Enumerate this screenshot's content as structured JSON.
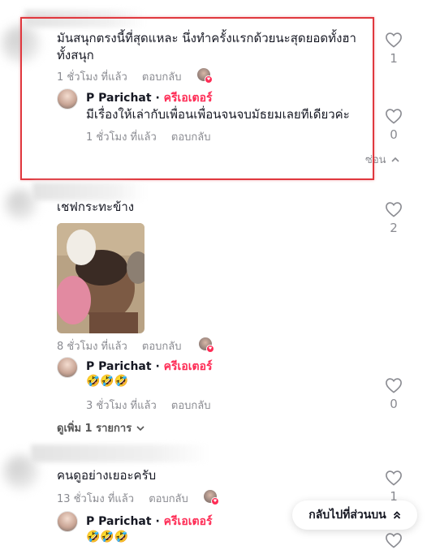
{
  "comment1": {
    "text": "มันสนุกตรงนี้ที่สุดแหละ นึ่งทำครั้งแรกด้วยนะสุดยอดทั้งฮาทั้งสนุก",
    "time": "1 ชั่วโมง ที่แล้ว",
    "reply_label": "ตอบกลับ",
    "likes": "1",
    "reply": {
      "author": "P Parichat",
      "separator": "·",
      "badge": "ครีเอเตอร์",
      "text": "มีเรื่องให้เล่ากับเพื่อนเพื่อนจนจบมัธยมเลยทีเดียวค่ะ",
      "time": "1 ชั่วโมง ที่แล้ว",
      "reply_label": "ตอบกลับ",
      "likes": "0"
    },
    "hide_label": "ซ่อน"
  },
  "comment2": {
    "text": "เชฟกระทะข้าง",
    "time": "8 ชั่วโมง ที่แล้ว",
    "reply_label": "ตอบกลับ",
    "likes": "2",
    "reply": {
      "author": "P Parichat",
      "separator": "·",
      "badge": "ครีเอเตอร์",
      "text": "🤣🤣🤣",
      "time": "3 ชั่วโมง ที่แล้ว",
      "reply_label": "ตอบกลับ",
      "likes": "0"
    },
    "more_label": "ดูเพิ่ม 1 รายการ"
  },
  "comment3": {
    "text": "คนดูอย่างเยอะครับ",
    "time": "13 ชั่วโมง ที่แล้ว",
    "reply_label": "ตอบกลับ",
    "likes": "1",
    "reply": {
      "author": "P Parichat",
      "separator": "·",
      "badge": "ครีเอเตอร์",
      "text": "🤣🤣🤣"
    }
  },
  "back_to_top": "กลับไปที่ส่วนบน",
  "colors": {
    "creator_badge": "#fe2c55",
    "highlight_border": "#e0383e",
    "muted_text": "#8a8b91"
  },
  "icons": {
    "like": "heart-outline-icon",
    "collapse": "chevron-up-icon",
    "expand": "chevron-down-icon",
    "back_to_top": "double-chevron-up-icon"
  }
}
